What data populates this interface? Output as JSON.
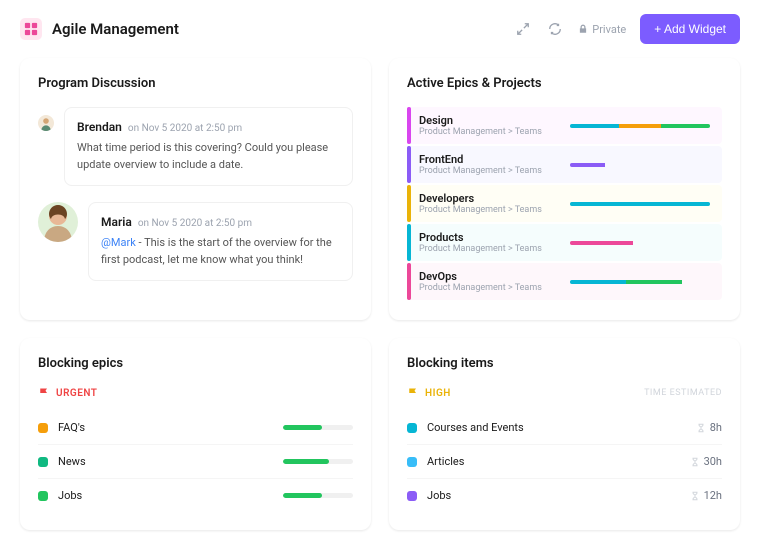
{
  "header": {
    "title": "Agile Management",
    "private_label": "Private",
    "add_widget_label": "+ Add Widget"
  },
  "discussion": {
    "title": "Program Discussion",
    "comments": [
      {
        "author": "Brendan",
        "meta": "on Nov 5 2020 at 2:50 pm",
        "text": "What time period is this covering? Could you please update overview to include a date."
      },
      {
        "author": "Maria",
        "meta": "on Nov 5 2020 at 2:50 pm",
        "mention": "@Mark",
        "text": " - This is the start of the overview for the first podcast, let me know what you think!"
      }
    ]
  },
  "epics": {
    "title": "Active Epics & Projects",
    "path": "Product Management > Teams",
    "items": [
      {
        "name": "Design",
        "segments": [
          {
            "c": "#06b6d4",
            "w": 35
          },
          {
            "c": "#f59e0b",
            "w": 30
          },
          {
            "c": "#22c55e",
            "w": 35
          }
        ]
      },
      {
        "name": "FrontEnd",
        "segments": [
          {
            "c": "#8b5cf6",
            "w": 25
          }
        ]
      },
      {
        "name": "Developers",
        "segments": [
          {
            "c": "#06b6d4",
            "w": 35
          },
          {
            "c": "#06b6d4",
            "w": 65
          }
        ]
      },
      {
        "name": "Products",
        "segments": [
          {
            "c": "#ec4899",
            "w": 45
          }
        ]
      },
      {
        "name": "DevOps",
        "segments": [
          {
            "c": "#06b6d4",
            "w": 40
          },
          {
            "c": "#22c55e",
            "w": 40
          }
        ]
      }
    ]
  },
  "blocking_epics": {
    "title": "Blocking epics",
    "tag": "URGENT",
    "items": [
      {
        "name": "FAQ's",
        "color": "#f59e0b",
        "pct": 55
      },
      {
        "name": "News",
        "color": "#10b981",
        "pct": 65
      },
      {
        "name": "Jobs",
        "color": "#22c55e",
        "pct": 55
      }
    ]
  },
  "blocking_items": {
    "title": "Blocking items",
    "tag": "HIGH",
    "col_header": "TIME ESTIMATED",
    "items": [
      {
        "name": "Courses and Events",
        "color": "#06b6d4",
        "time": "8h"
      },
      {
        "name": "Articles",
        "color": "#38bdf8",
        "time": "30h"
      },
      {
        "name": "Jobs",
        "color": "#8b5cf6",
        "time": "12h"
      }
    ]
  }
}
